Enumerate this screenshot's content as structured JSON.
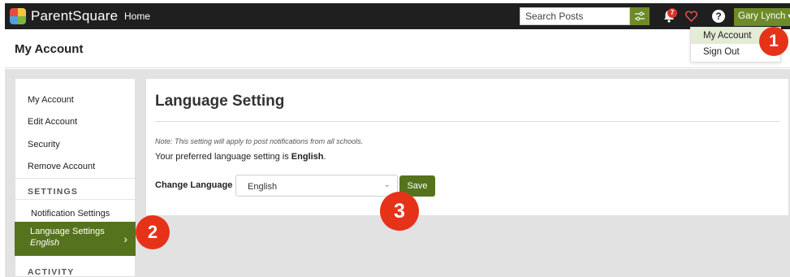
{
  "topbar": {
    "brand": "ParentSquare",
    "home": "Home",
    "search_placeholder": "Search Posts",
    "notification_count": "7",
    "help": "?",
    "user_name": "Gary Lynch",
    "caret": "▾",
    "colors": {
      "bar": "#1f1f1f",
      "accent": "#6d8b28",
      "badge": "#d9362b"
    },
    "icons": [
      "filter-icon",
      "bell-icon",
      "heart-icon",
      "help-icon",
      "chevron-down-icon"
    ]
  },
  "user_menu": {
    "items": [
      {
        "label": "My Account"
      },
      {
        "label": "Sign Out"
      }
    ]
  },
  "header": {
    "title": "My Account"
  },
  "sidebar": {
    "items": [
      {
        "label": "My Account"
      },
      {
        "label": "Edit Account"
      },
      {
        "label": "Security"
      },
      {
        "label": "Remove Account"
      }
    ],
    "settings_heading": "SETTINGS",
    "settings_items": [
      {
        "label": "Notification Settings"
      },
      {
        "label": "Language Settings",
        "sub": "English"
      }
    ],
    "activity_heading": "ACTIVITY",
    "chevron": "›",
    "active_color": "#55731d"
  },
  "content": {
    "title": "Language Setting",
    "note": "Note: This setting will apply to post notifications from all schools.",
    "pref_prefix": "Your preferred language setting is ",
    "pref_value": "English",
    "pref_suffix": ".",
    "change_label": "Change Language",
    "select_value": "English",
    "select_caret": "⌄",
    "save_label": "Save"
  },
  "annotations": {
    "step1": "1",
    "step2": "2",
    "step3": "3",
    "color": "#e63219"
  }
}
